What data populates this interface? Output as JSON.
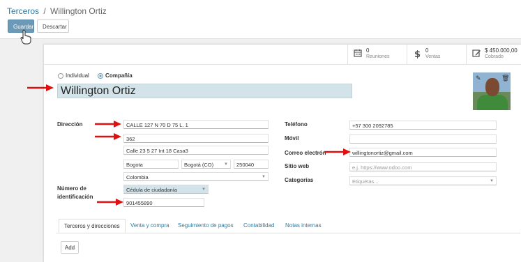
{
  "breadcrumb": {
    "parent": "Terceros",
    "separator": "/",
    "current": "Willington Ortiz"
  },
  "toolbar": {
    "save_label": "Guardar",
    "discard_label": "Descartar"
  },
  "stats": [
    {
      "icon": "calendar-icon",
      "value": "0",
      "label": "Reuniones"
    },
    {
      "icon": "dollar-icon",
      "value": "0",
      "label": "Ventas"
    },
    {
      "icon": "edit-invoice-icon",
      "value": "$ 450.000,00",
      "label": "Cobrado"
    }
  ],
  "company_type": {
    "individual_label": "Individual",
    "company_label": "Compañía",
    "selected": "Compañía"
  },
  "partner": {
    "name": "Willington Ortiz"
  },
  "address": {
    "label": "Dirección",
    "street": "CALLE 127 N 70 D 75 L. 1",
    "street2": "362",
    "street3": "Calle 23 5 27 Int 18 Casa3",
    "city": "Bogota",
    "state": "Bogotá (CO)",
    "zip": "250040",
    "country": "Colombia"
  },
  "identification": {
    "label_line1": "Número de",
    "label_line2": "identificación",
    "type": "Cédula de ciudadanía",
    "number": "901455890"
  },
  "contact": {
    "phone_label": "Teléfono",
    "phone": "+57 300 2092785",
    "mobile_label": "Móvil",
    "mobile": "",
    "email_label": "Correo electrón",
    "email": "willingtonortiz@gmail.com",
    "website_label": "Sitio web",
    "website_placeholder": "e.j. https://www.odoo.com",
    "categories_label": "Categorías",
    "categories_placeholder": "Etiquetas..."
  },
  "tabs": [
    "Terceros y direcciones",
    "Venta y compra",
    "Seguimiento de pagos",
    "Contabilidad",
    "Notas internas"
  ],
  "add_label": "Add",
  "colors": {
    "accent": "#2d7aa2",
    "primary_button": "#6b9ab8",
    "annotation_arrow": "#e01010",
    "highlight_field": "#d2e3ea"
  }
}
